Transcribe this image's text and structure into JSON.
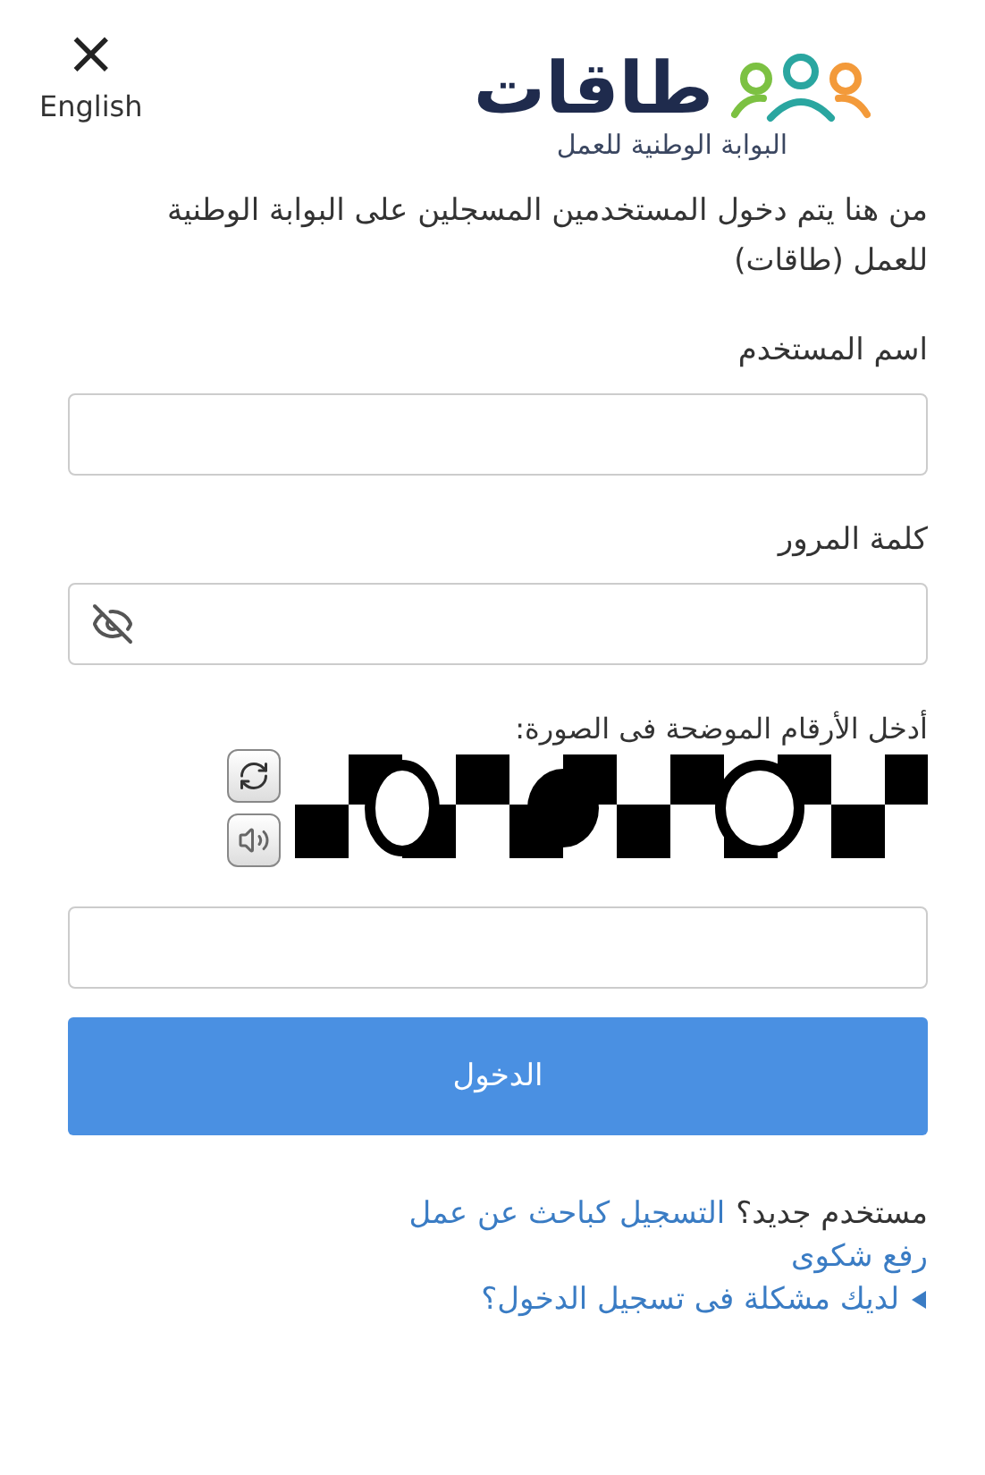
{
  "header": {
    "close": "×",
    "language": "English",
    "logo_title": "طاقات",
    "logo_subtitle": "البوابة الوطنية للعمل"
  },
  "intro": "من هنا يتم دخول المستخدمين المسجلين على البوابة الوطنية للعمل (طاقات)",
  "fields": [
    {
      "label": "اسم المستخدم",
      "kind": "text"
    },
    {
      "label": "كلمة المرور",
      "kind": "password"
    }
  ],
  "captcha": {
    "label": "أدخل الأرقام الموضحة فى الصورة:"
  },
  "login_button": "الدخول",
  "footer": {
    "new_user": "مستخدم جديد؟",
    "register_link": "التسجيل كباحث عن عمل",
    "complaint_link": "رفع شكوى",
    "problem_link": "لديك مشكلة فى تسجيل الدخول؟",
    "problem_expanded": false
  }
}
